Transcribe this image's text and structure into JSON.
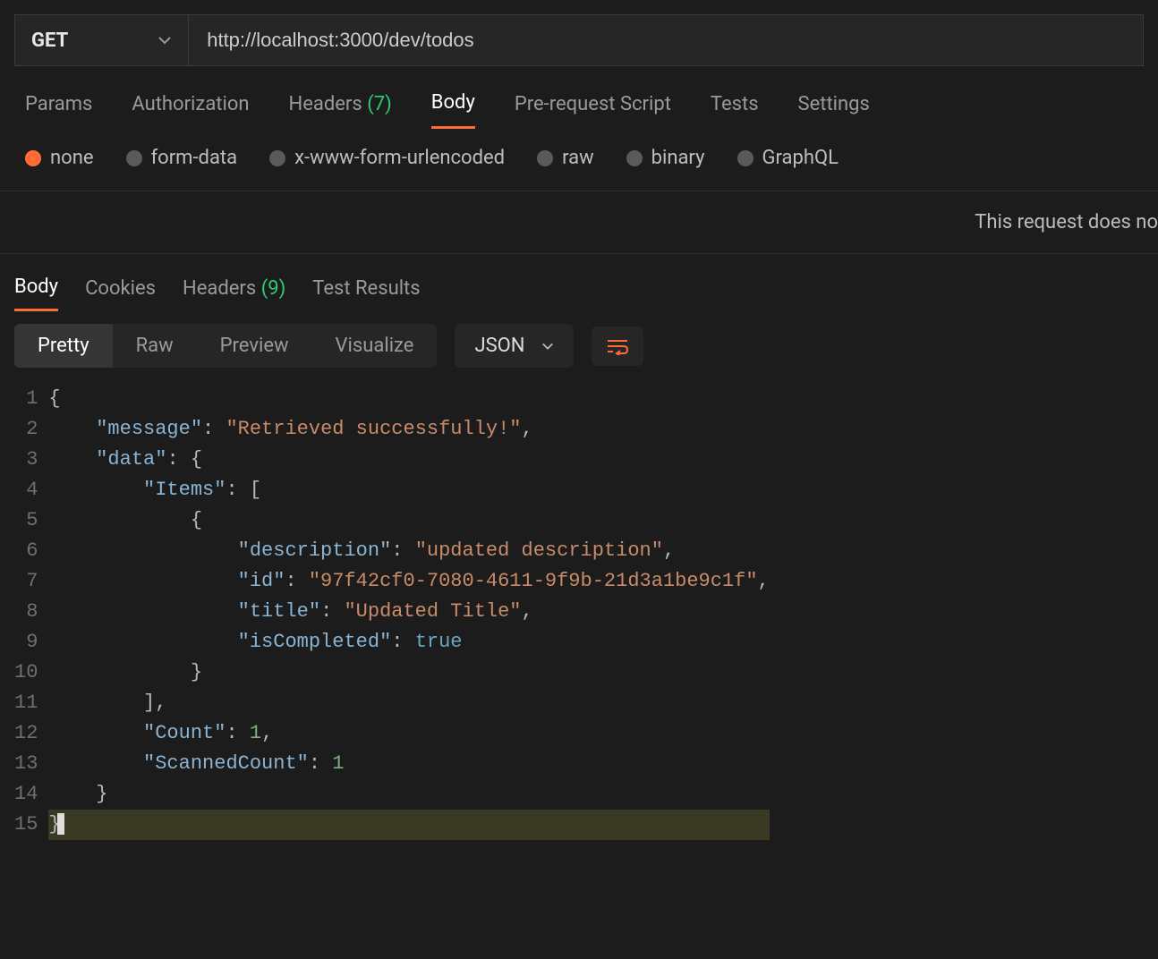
{
  "request": {
    "method": "GET",
    "url": "http://localhost:3000/dev/todos"
  },
  "tabs": {
    "items": [
      "Params",
      "Authorization",
      "Headers",
      "Body",
      "Pre-request Script",
      "Tests",
      "Settings"
    ],
    "headers_count": "(7)",
    "active": "Body"
  },
  "body_types": {
    "options": [
      "none",
      "form-data",
      "x-www-form-urlencoded",
      "raw",
      "binary",
      "GraphQL"
    ],
    "selected": "none"
  },
  "hint": "This request does no",
  "response_tabs": {
    "items": [
      "Body",
      "Cookies",
      "Headers",
      "Test Results"
    ],
    "headers_count": "(9)",
    "active": "Body"
  },
  "view_modes": {
    "options": [
      "Pretty",
      "Raw",
      "Preview",
      "Visualize"
    ],
    "active": "Pretty"
  },
  "format": "JSON",
  "code": {
    "line_numbers": [
      "1",
      "2",
      "3",
      "4",
      "5",
      "6",
      "7",
      "8",
      "9",
      "10",
      "11",
      "12",
      "13",
      "14",
      "15"
    ],
    "lines": [
      [
        {
          "t": "punc",
          "v": "{"
        }
      ],
      [
        {
          "t": "indent",
          "v": "    "
        },
        {
          "t": "key",
          "v": "\"message\""
        },
        {
          "t": "punc",
          "v": ": "
        },
        {
          "t": "str",
          "v": "\"Retrieved successfully!\""
        },
        {
          "t": "punc",
          "v": ","
        }
      ],
      [
        {
          "t": "indent",
          "v": "    "
        },
        {
          "t": "key",
          "v": "\"data\""
        },
        {
          "t": "punc",
          "v": ": "
        },
        {
          "t": "punc",
          "v": "{"
        }
      ],
      [
        {
          "t": "indent",
          "v": "        "
        },
        {
          "t": "key",
          "v": "\"Items\""
        },
        {
          "t": "punc",
          "v": ": "
        },
        {
          "t": "punc",
          "v": "["
        }
      ],
      [
        {
          "t": "indent",
          "v": "            "
        },
        {
          "t": "punc",
          "v": "{"
        }
      ],
      [
        {
          "t": "indent",
          "v": "                "
        },
        {
          "t": "key",
          "v": "\"description\""
        },
        {
          "t": "punc",
          "v": ": "
        },
        {
          "t": "str",
          "v": "\"updated description\""
        },
        {
          "t": "punc",
          "v": ","
        }
      ],
      [
        {
          "t": "indent",
          "v": "                "
        },
        {
          "t": "key",
          "v": "\"id\""
        },
        {
          "t": "punc",
          "v": ": "
        },
        {
          "t": "str",
          "v": "\"97f42cf0-7080-4611-9f9b-21d3a1be9c1f\""
        },
        {
          "t": "punc",
          "v": ","
        }
      ],
      [
        {
          "t": "indent",
          "v": "                "
        },
        {
          "t": "key",
          "v": "\"title\""
        },
        {
          "t": "punc",
          "v": ": "
        },
        {
          "t": "str",
          "v": "\"Updated Title\""
        },
        {
          "t": "punc",
          "v": ","
        }
      ],
      [
        {
          "t": "indent",
          "v": "                "
        },
        {
          "t": "key",
          "v": "\"isCompleted\""
        },
        {
          "t": "punc",
          "v": ": "
        },
        {
          "t": "bool",
          "v": "true"
        }
      ],
      [
        {
          "t": "indent",
          "v": "            "
        },
        {
          "t": "punc",
          "v": "}"
        }
      ],
      [
        {
          "t": "indent",
          "v": "        "
        },
        {
          "t": "punc",
          "v": "],"
        }
      ],
      [
        {
          "t": "indent",
          "v": "        "
        },
        {
          "t": "key",
          "v": "\"Count\""
        },
        {
          "t": "punc",
          "v": ": "
        },
        {
          "t": "num",
          "v": "1"
        },
        {
          "t": "punc",
          "v": ","
        }
      ],
      [
        {
          "t": "indent",
          "v": "        "
        },
        {
          "t": "key",
          "v": "\"ScannedCount\""
        },
        {
          "t": "punc",
          "v": ": "
        },
        {
          "t": "num",
          "v": "1"
        }
      ],
      [
        {
          "t": "indent",
          "v": "    "
        },
        {
          "t": "punc",
          "v": "}"
        }
      ],
      [
        {
          "t": "punc",
          "v": "}"
        }
      ]
    ]
  }
}
